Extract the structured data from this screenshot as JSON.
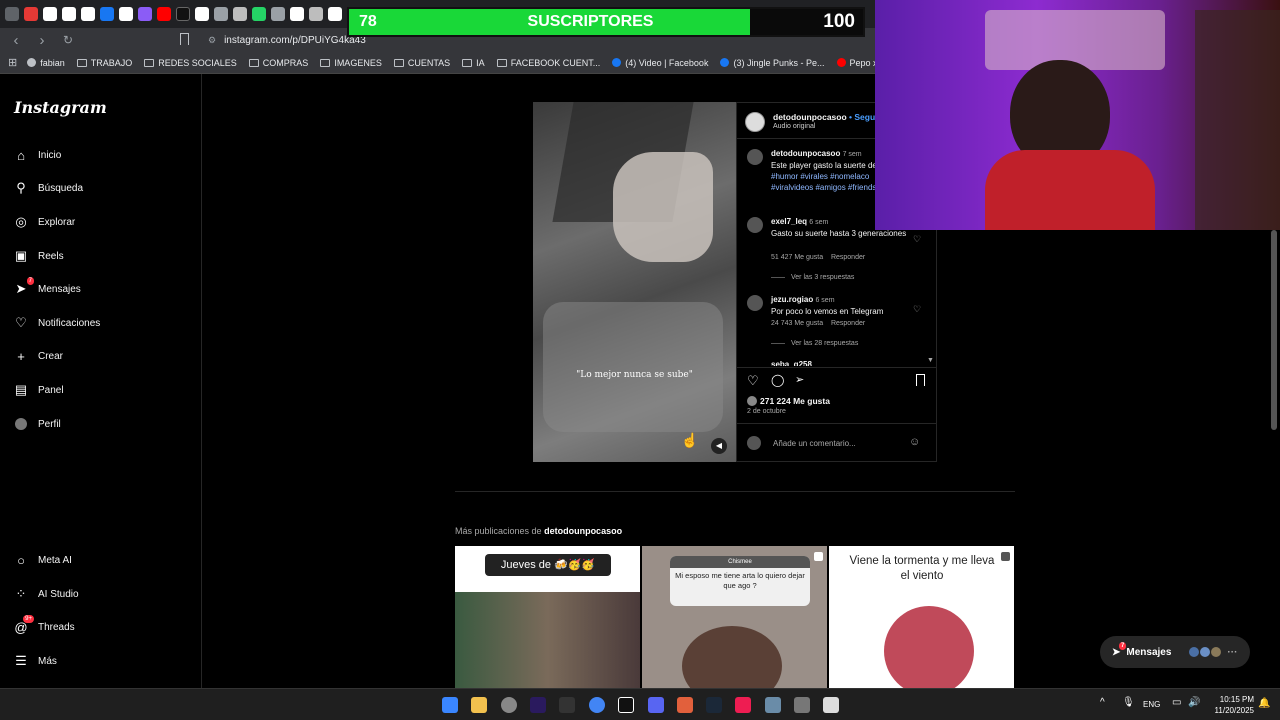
{
  "browser": {
    "url": "instagram.com/p/DPUiYG4ka43",
    "bookmarks": [
      "fabian",
      "TRABAJO",
      "REDES SOCIALES",
      "COMPRAS",
      "IMAGENES",
      "CUENTAS",
      "IA",
      "FACEBOOK CUENT...",
      "(4) Video | Facebook",
      "(3) Jingle Punks - Pe...",
      "Pepo x @kazu.oficia..."
    ]
  },
  "sidebar": {
    "logo": "Instagram",
    "items": [
      {
        "label": "Inicio",
        "icon": "home-icon"
      },
      {
        "label": "Búsqueda",
        "icon": "search-icon"
      },
      {
        "label": "Explorar",
        "icon": "compass-icon"
      },
      {
        "label": "Reels",
        "icon": "reels-icon"
      },
      {
        "label": "Mensajes",
        "icon": "messenger-icon",
        "badge": "7"
      },
      {
        "label": "Notificaciones",
        "icon": "heart-icon"
      },
      {
        "label": "Crear",
        "icon": "plus-icon"
      },
      {
        "label": "Panel",
        "icon": "chart-icon"
      },
      {
        "label": "Perfil",
        "icon": "avatar-icon"
      }
    ],
    "bottom": [
      {
        "label": "Meta AI",
        "icon": "meta-ai-icon"
      },
      {
        "label": "AI Studio",
        "icon": "ai-studio-icon"
      },
      {
        "label": "Threads",
        "icon": "threads-icon",
        "badge": "9+"
      },
      {
        "label": "Más",
        "icon": "menu-icon"
      }
    ]
  },
  "post": {
    "video_caption": "\"Lo mejor nunca se sube\"",
    "author": "detodounpocasoo",
    "follow": "• Seguir",
    "audio": "Audio original",
    "description": {
      "user": "detodounpocasoo",
      "time": "7 sem",
      "text": "Este player gasto la suerte de vida . 🙈",
      "hashtags": "#humor #virales #nomelaco #viralvideos #amigos #friends"
    },
    "comments": [
      {
        "user": "exel7_leq",
        "time": "6 sem",
        "text": "Gasto su suerte hasta 3 generaciones",
        "likes": "51 427 Me gusta",
        "reply": "Responder",
        "replies": "Ver las 3 respuestas"
      },
      {
        "user": "jezu.rogiao",
        "time": "6 sem",
        "text": "Por poco lo vemos en Telegram",
        "likes": "24 743 Me gusta",
        "reply": "Responder",
        "replies": "Ver las 28 respuestas"
      },
      {
        "user": "seba_g258",
        "time": "6 sem",
        "text": ""
      }
    ],
    "likes": "271 224 Me gusta",
    "date": "2 de octubre",
    "comment_placeholder": "Añade un comentario..."
  },
  "more": {
    "prefix": "Más publicaciones de",
    "user": "detodounpocasoo",
    "thumbs": [
      {
        "text": "Jueves de 🍻🥳🥳",
        "bg": "#ffffff"
      },
      {
        "text": "Mi esposo me tiene arta lo quiero dejar que ago ?",
        "header": "Chismee",
        "bg": "#9a8f88"
      },
      {
        "text": "Viene la tormenta y me lleva el viento",
        "bg": "#ffffff"
      }
    ]
  },
  "floating": {
    "label": "Mensajes",
    "badge": "7"
  },
  "overlay": {
    "subs_count": "78",
    "subs_label": "SUSCRIPTORES",
    "subs_goal": "100",
    "subs_progress": 0.78
  },
  "taskbar": {
    "lang": "ENG",
    "time": "10:15 PM",
    "date": "11/20/2025"
  },
  "colors": {
    "accent": "#19d838",
    "badge": "#ff3040",
    "bg": "#000000"
  }
}
